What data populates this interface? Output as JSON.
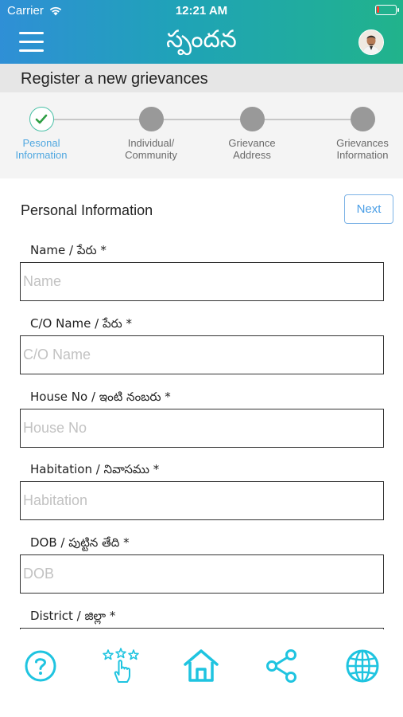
{
  "status_bar": {
    "carrier": "Carrier",
    "time": "12:21 AM",
    "battery_level": 0.15
  },
  "header": {
    "title": "స్పందన"
  },
  "page_title": "Register a new grievances",
  "steps": [
    {
      "label_line1": "Pesonal",
      "label_line2": "Information",
      "state": "done"
    },
    {
      "label_line1": "Individual/",
      "label_line2": "Community",
      "state": "pending"
    },
    {
      "label_line1": "Grievance",
      "label_line2": "Address",
      "state": "pending"
    },
    {
      "label_line1": "Grievances",
      "label_line2": "Information",
      "state": "pending"
    }
  ],
  "section": {
    "title": "Personal Information",
    "next_label": "Next"
  },
  "fields": [
    {
      "label": "Name / పేరు *",
      "placeholder": "Name",
      "value": ""
    },
    {
      "label": "C/O Name / పేరు *",
      "placeholder": "C/O Name",
      "value": ""
    },
    {
      "label": "House No / ఇంటి నంబరు *",
      "placeholder": "House No",
      "value": ""
    },
    {
      "label": "Habitation / నివాసము *",
      "placeholder": "Habitation",
      "value": ""
    },
    {
      "label": "DOB / పుట్టిన తేది *",
      "placeholder": "DOB",
      "value": ""
    },
    {
      "label": "District / జిల్లా *",
      "placeholder": "",
      "value": ""
    }
  ],
  "tabbar": [
    {
      "icon": "help-icon"
    },
    {
      "icon": "rate-icon"
    },
    {
      "icon": "home-icon"
    },
    {
      "icon": "share-icon"
    },
    {
      "icon": "globe-icon"
    }
  ],
  "colors": {
    "header_gradient_start": "#2f8fd6",
    "header_gradient_end": "#21b38b",
    "accent_blue": "#4a9ee6",
    "step_done_green": "#49c0a6",
    "step_pending": "#999999",
    "tab_icon_cyan": "#1fc4e0",
    "battery_low": "#ff3b30"
  }
}
